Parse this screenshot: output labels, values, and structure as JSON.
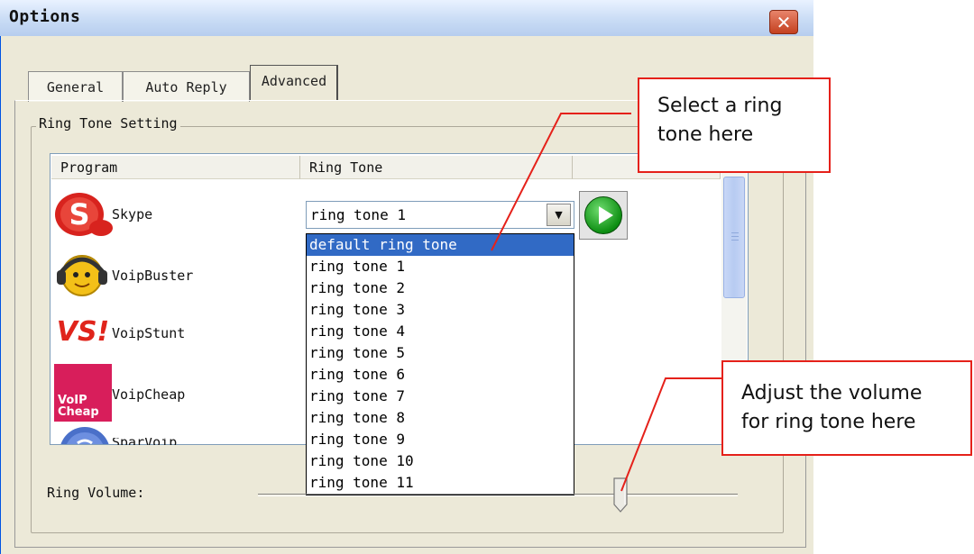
{
  "window": {
    "title": "Options",
    "close_icon": "close-icon"
  },
  "tabs": [
    {
      "label": "General",
      "active": false
    },
    {
      "label": "Auto Reply",
      "active": false
    },
    {
      "label": "Advanced",
      "active": true
    }
  ],
  "ring_tone_group": {
    "label": "Ring Tone Setting",
    "columns": [
      "Program",
      "Ring Tone"
    ],
    "programs": [
      {
        "name": "Skype",
        "icon": "skype-icon",
        "selected_ring_tone": "ring tone 1"
      },
      {
        "name": "VoipBuster",
        "icon": "voipbuster-icon"
      },
      {
        "name": "VoipStunt",
        "icon": "voipstunt-icon",
        "icon_text": "VS!"
      },
      {
        "name": "VoipCheap",
        "icon": "voipcheap-icon",
        "icon_text": "VoIP Cheap"
      },
      {
        "name": "SparVoip",
        "icon": "sparvoip-icon"
      }
    ],
    "dropdown_options": [
      "default ring tone",
      "ring tone 1",
      "ring tone 2",
      "ring tone 3",
      "ring tone 4",
      "ring tone 5",
      "ring tone 6",
      "ring tone 7",
      "ring tone 8",
      "ring tone 9",
      "ring tone 10",
      "ring tone 11"
    ],
    "highlighted_option": "default ring tone",
    "play_icon": "play-icon",
    "volume_label": "Ring Volume:",
    "volume_fraction": 0.74
  },
  "callouts": {
    "ring_tone": "Select a ring tone here",
    "ring_tone_lines": [
      "Select a ring",
      "tone here"
    ],
    "volume_lines": [
      "Adjust the volume",
      "for ring tone here"
    ]
  },
  "colors": {
    "selection": "#316ac5",
    "callout_border": "#e5211a",
    "close_button": "#c4401f"
  }
}
